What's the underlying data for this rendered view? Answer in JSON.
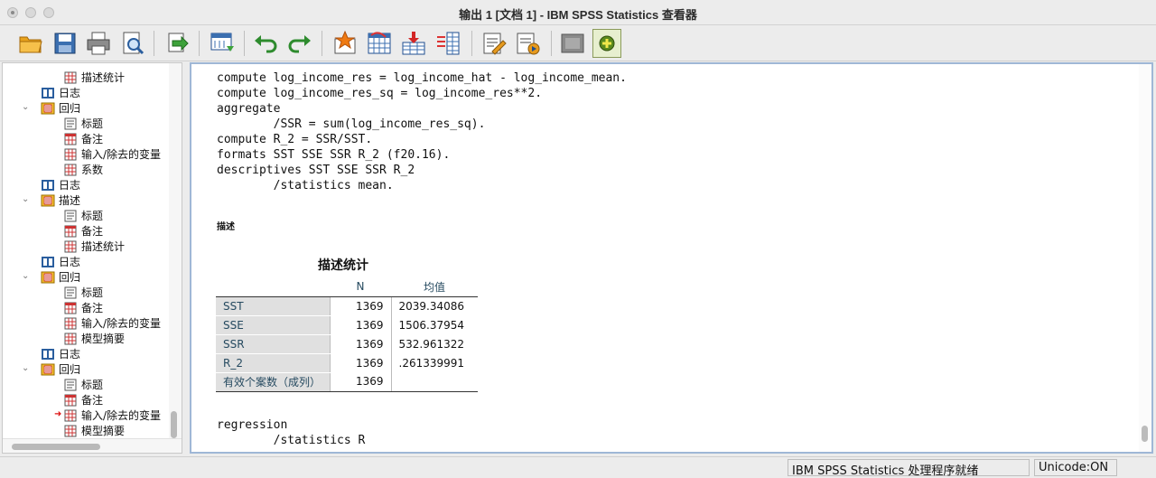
{
  "window": {
    "title": "输出 1 [文档 1] - IBM SPSS Statistics 查看器"
  },
  "toolbar": {
    "buttons": [
      "open-folder-icon",
      "save-icon",
      "print-icon",
      "print-preview-icon",
      "export-icon",
      "goto-data-icon",
      "undo-icon",
      "redo-icon",
      "goto-case-icon",
      "goto-variable-icon",
      "insert-output-icon",
      "variables-icon",
      "create-title-icon",
      "designate-window-icon",
      "pivot-disabled-icon",
      "new-output-icon"
    ]
  },
  "navigator": {
    "items": [
      {
        "label": "描述统计",
        "icon": "table-icon",
        "level": 2
      },
      {
        "label": "日志",
        "icon": "log-book-icon",
        "level": 1
      },
      {
        "label": "回归",
        "icon": "procedure-icon",
        "level": 1,
        "expanded": true
      },
      {
        "label": "标题",
        "icon": "title-icon",
        "level": 2
      },
      {
        "label": "备注",
        "icon": "notes-icon",
        "level": 2
      },
      {
        "label": "输入/除去的变量",
        "icon": "table-icon",
        "level": 2
      },
      {
        "label": "系数",
        "icon": "table-icon",
        "level": 2
      },
      {
        "label": "日志",
        "icon": "log-book-icon",
        "level": 1
      },
      {
        "label": "描述",
        "icon": "procedure-icon",
        "level": 1,
        "expanded": true
      },
      {
        "label": "标题",
        "icon": "title-icon",
        "level": 2
      },
      {
        "label": "备注",
        "icon": "notes-icon",
        "level": 2
      },
      {
        "label": "描述统计",
        "icon": "table-icon",
        "level": 2
      },
      {
        "label": "日志",
        "icon": "log-book-icon",
        "level": 1
      },
      {
        "label": "回归",
        "icon": "procedure-icon",
        "level": 1,
        "expanded": true
      },
      {
        "label": "标题",
        "icon": "title-icon",
        "level": 2
      },
      {
        "label": "备注",
        "icon": "notes-icon",
        "level": 2
      },
      {
        "label": "输入/除去的变量",
        "icon": "table-icon",
        "level": 2
      },
      {
        "label": "模型摘要",
        "icon": "table-icon",
        "level": 2
      },
      {
        "label": "日志",
        "icon": "log-book-icon",
        "level": 1
      },
      {
        "label": "回归",
        "icon": "procedure-icon",
        "level": 1,
        "expanded": true
      },
      {
        "label": "标题",
        "icon": "title-icon",
        "level": 2
      },
      {
        "label": "备注",
        "icon": "notes-icon",
        "level": 2
      },
      {
        "label": "输入/除去的变量",
        "icon": "table-icon",
        "level": 2,
        "current": true
      },
      {
        "label": "模型摘要",
        "icon": "table-icon",
        "level": 2
      }
    ]
  },
  "output": {
    "syntax_lines": [
      "compute log_income_res = log_income_hat - log_income_mean.",
      "compute log_income_res_sq = log_income_res**2.",
      "aggregate",
      "        /SSR = sum(log_income_res_sq).",
      "compute R_2 = SSR/SST.",
      "formats SST SSE SSR R_2 (f20.16).",
      "descriptives SST SSE SSR R_2",
      "        /statistics mean."
    ],
    "section_title": "描述",
    "table": {
      "title": "描述统计",
      "headers": [
        "",
        "N",
        "均值"
      ],
      "rows": [
        {
          "label": "SST",
          "n": "1369",
          "mean": "2039.34086"
        },
        {
          "label": "SSE",
          "n": "1369",
          "mean": "1506.37954"
        },
        {
          "label": "SSR",
          "n": "1369",
          "mean": "532.961322"
        },
        {
          "label": "R_2",
          "n": "1369",
          "mean": ".261339991"
        },
        {
          "label": "有效个案数（成列）",
          "n": "1369",
          "mean": ""
        }
      ]
    },
    "syntax_lines_2": [
      "regression",
      "        /statistics R"
    ]
  },
  "status": {
    "processor": "IBM SPSS Statistics 处理程序就绪",
    "unicode": "Unicode:ON"
  }
}
